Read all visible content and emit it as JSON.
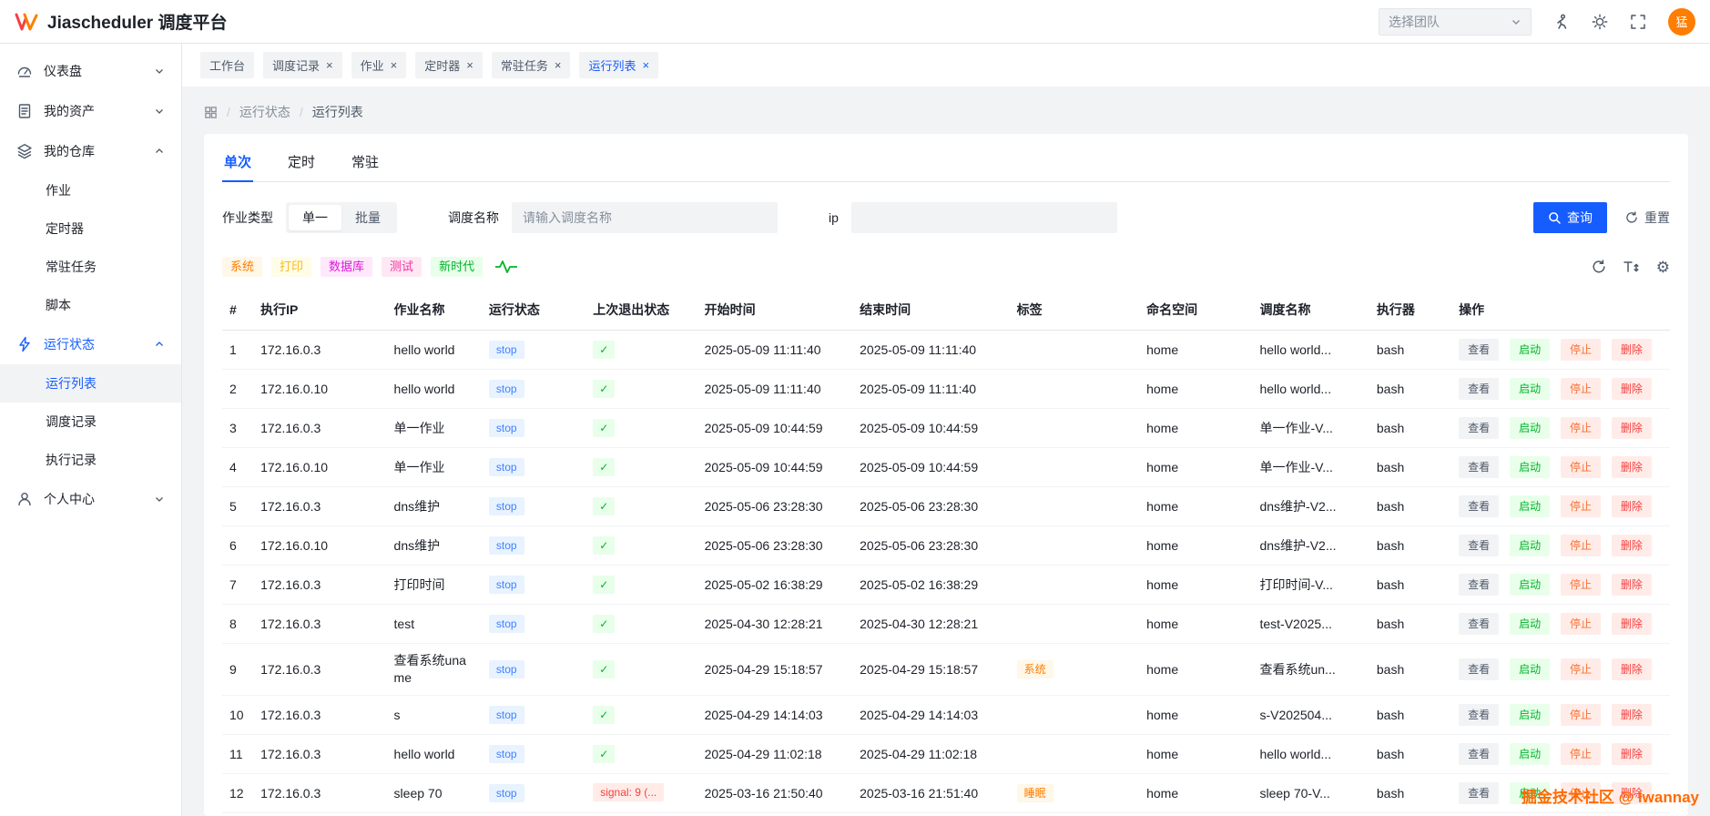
{
  "header": {
    "title": "Jiascheduler 调度平台",
    "team_select": "选择团队",
    "avatar_text": "猛"
  },
  "tabstrip": {
    "tabs": [
      {
        "label": "工作台"
      },
      {
        "label": "调度记录"
      },
      {
        "label": "作业"
      },
      {
        "label": "定时器"
      },
      {
        "label": "常驻任务"
      },
      {
        "label": "运行列表"
      }
    ]
  },
  "breadcrumb": {
    "level1": "运行状态",
    "level2": "运行列表"
  },
  "sidebar": {
    "dashboard": "仪表盘",
    "assets": "我的资产",
    "repo": "我的仓库",
    "repo_children": [
      "作业",
      "定时器",
      "常驻任务",
      "脚本"
    ],
    "runstatus": "运行状态",
    "runstatus_children": [
      "运行列表",
      "调度记录",
      "执行记录"
    ],
    "personal": "个人中心"
  },
  "panel": {
    "tabs": [
      "单次",
      "定时",
      "常驻"
    ],
    "filter": {
      "job_type_label": "作业类型",
      "job_type_options": [
        "单一",
        "批量"
      ],
      "sched_label": "调度名称",
      "sched_placeholder": "请输入调度名称",
      "ip_label": "ip",
      "search": "查询",
      "reset": "重置"
    },
    "tags": [
      "系统",
      "打印",
      "数据库",
      "测试",
      "新时代"
    ]
  },
  "table": {
    "headers": [
      "#",
      "执行IP",
      "作业名称",
      "运行状态",
      "上次退出状态",
      "开始时间",
      "结束时间",
      "标签",
      "命名空间",
      "调度名称",
      "执行器",
      "操作"
    ],
    "actions": {
      "view": "查看",
      "start": "启动",
      "stop": "停止",
      "del": "删除"
    },
    "ok_mark": "✓",
    "rows": [
      {
        "num": "1",
        "ip": "172.16.0.3",
        "job": "hello world",
        "status": "stop",
        "start": "2025-05-09 11:11:40",
        "end": "2025-05-09 11:11:40",
        "ns": "home",
        "sched": "hello world...",
        "exec": "bash"
      },
      {
        "num": "2",
        "ip": "172.16.0.10",
        "job": "hello world",
        "status": "stop",
        "start": "2025-05-09 11:11:40",
        "end": "2025-05-09 11:11:40",
        "ns": "home",
        "sched": "hello world...",
        "exec": "bash"
      },
      {
        "num": "3",
        "ip": "172.16.0.3",
        "job": "单一作业",
        "status": "stop",
        "start": "2025-05-09 10:44:59",
        "end": "2025-05-09 10:44:59",
        "ns": "home",
        "sched": "单一作业-V...",
        "exec": "bash"
      },
      {
        "num": "4",
        "ip": "172.16.0.10",
        "job": "单一作业",
        "status": "stop",
        "start": "2025-05-09 10:44:59",
        "end": "2025-05-09 10:44:59",
        "ns": "home",
        "sched": "单一作业-V...",
        "exec": "bash"
      },
      {
        "num": "5",
        "ip": "172.16.0.3",
        "job": "dns维护",
        "status": "stop",
        "start": "2025-05-06 23:28:30",
        "end": "2025-05-06 23:28:30",
        "ns": "home",
        "sched": "dns维护-V2...",
        "exec": "bash"
      },
      {
        "num": "6",
        "ip": "172.16.0.10",
        "job": "dns维护",
        "status": "stop",
        "start": "2025-05-06 23:28:30",
        "end": "2025-05-06 23:28:30",
        "ns": "home",
        "sched": "dns维护-V2...",
        "exec": "bash"
      },
      {
        "num": "7",
        "ip": "172.16.0.3",
        "job": "打印时间",
        "status": "stop",
        "start": "2025-05-02 16:38:29",
        "end": "2025-05-02 16:38:29",
        "ns": "home",
        "sched": "打印时间-V...",
        "exec": "bash"
      },
      {
        "num": "8",
        "ip": "172.16.0.3",
        "job": "test",
        "status": "stop",
        "start": "2025-04-30 12:28:21",
        "end": "2025-04-30 12:28:21",
        "ns": "home",
        "sched": "test-V2025...",
        "exec": "bash"
      },
      {
        "num": "9",
        "ip": "172.16.0.3",
        "job": "查看系统uname",
        "status": "stop",
        "start": "2025-04-29 15:18:57",
        "end": "2025-04-29 15:18:57",
        "tag": "系统",
        "ns": "home",
        "sched": "查看系统un...",
        "exec": "bash"
      },
      {
        "num": "10",
        "ip": "172.16.0.3",
        "job": "s",
        "status": "stop",
        "start": "2025-04-29 14:14:03",
        "end": "2025-04-29 14:14:03",
        "ns": "home",
        "sched": "s-V202504...",
        "exec": "bash"
      },
      {
        "num": "11",
        "ip": "172.16.0.3",
        "job": "hello world",
        "status": "stop",
        "start": "2025-04-29 11:02:18",
        "end": "2025-04-29 11:02:18",
        "ns": "home",
        "sched": "hello world...",
        "exec": "bash"
      },
      {
        "num": "12",
        "ip": "172.16.0.3",
        "job": "sleep 70",
        "status": "stop",
        "exit": "signal: 9 (...",
        "start": "2025-03-16 21:50:40",
        "end": "2025-03-16 21:51:40",
        "tag": "睡眠",
        "ns": "home",
        "sched": "sleep 70-V...",
        "exec": "bash"
      }
    ]
  },
  "watermark": "掘金技术社区 @ iwannay"
}
